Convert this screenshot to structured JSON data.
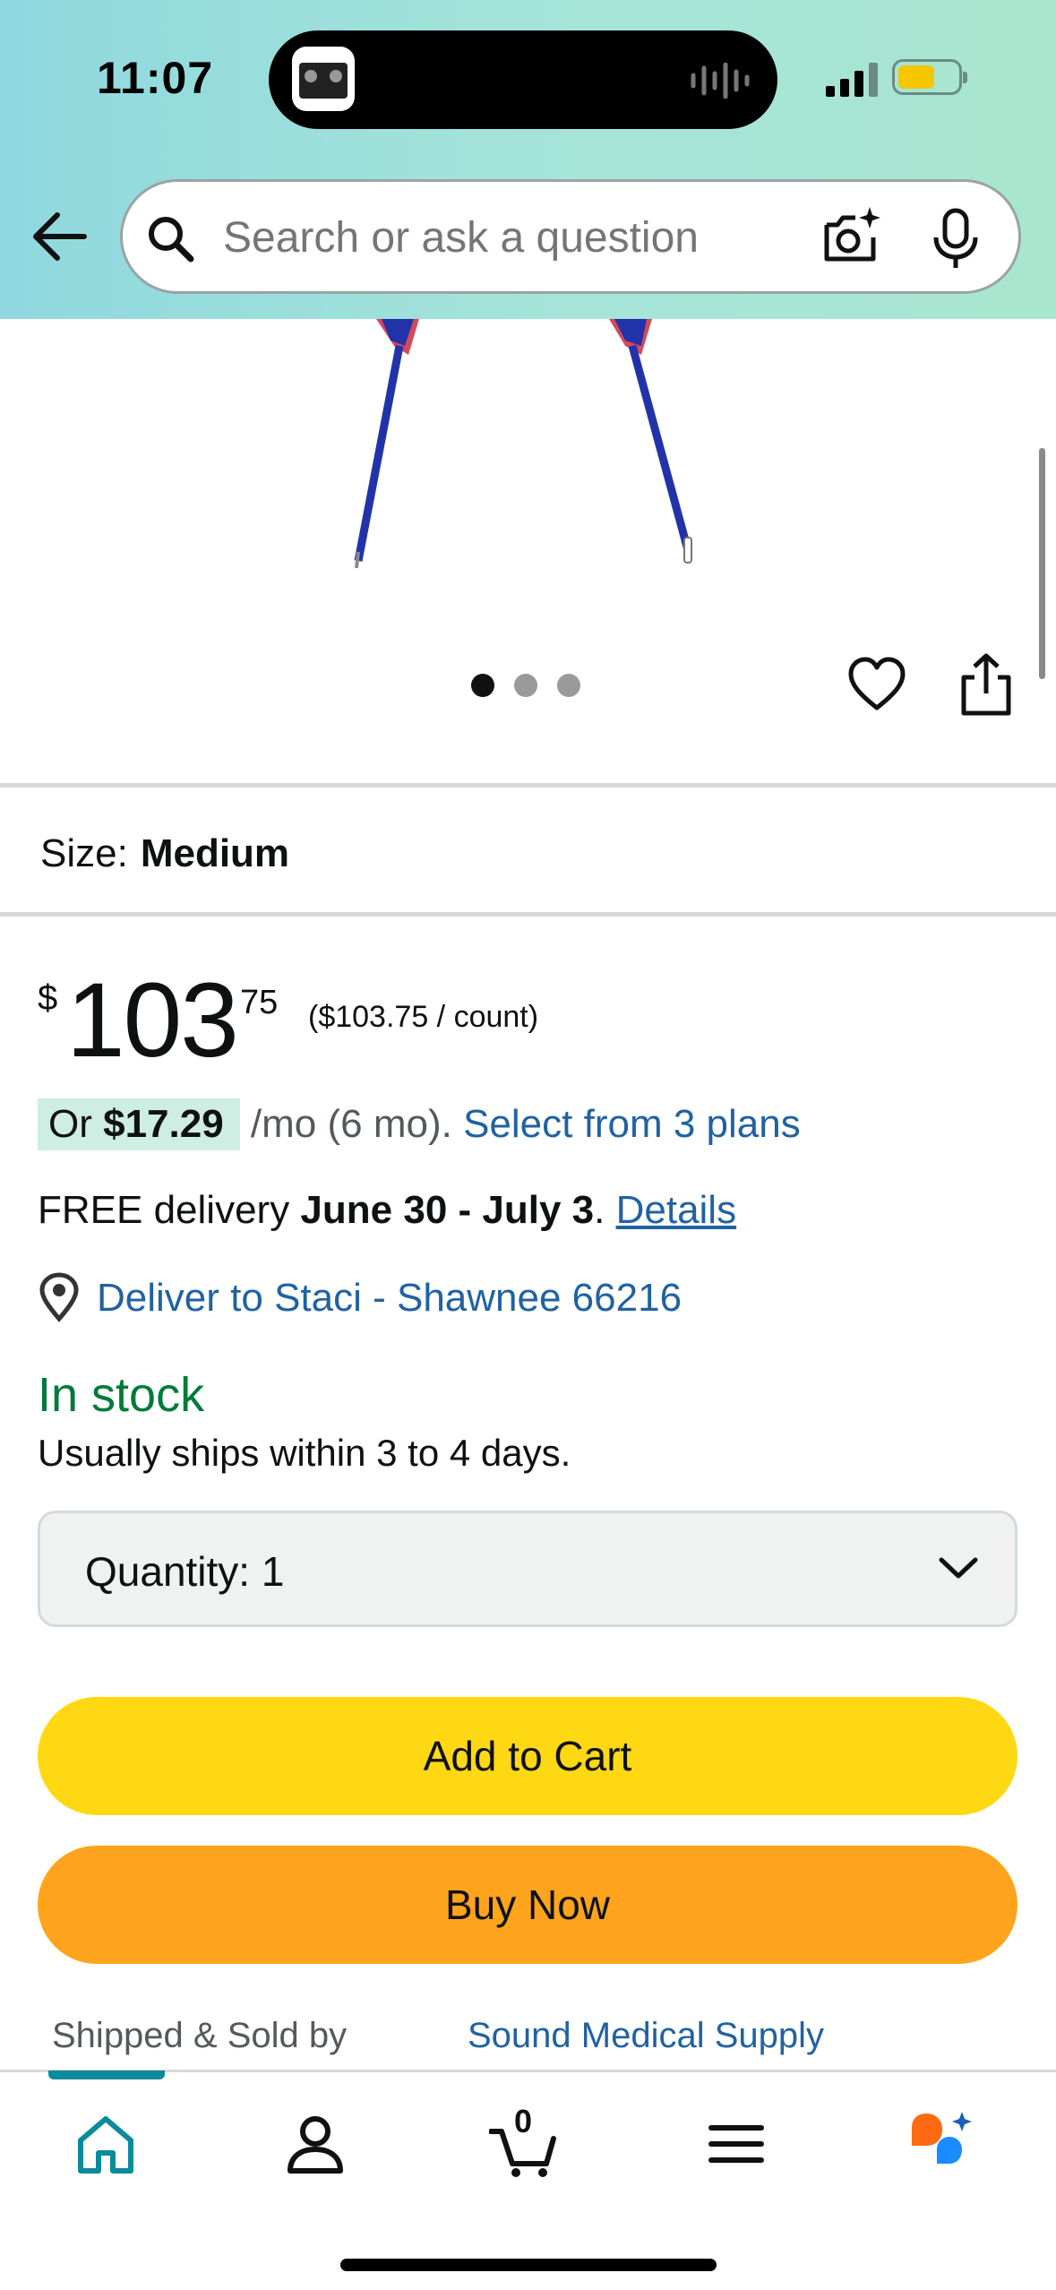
{
  "status_bar": {
    "time": "11:07"
  },
  "header": {
    "search_placeholder": "Search or ask a question",
    "icons": [
      "back-arrow-icon",
      "search-icon",
      "camera-icon",
      "mic-icon"
    ]
  },
  "gallery": {
    "image_count": 3,
    "active_index": 0
  },
  "product": {
    "size_label": "Size:",
    "size_value": "Medium",
    "price_symbol": "$",
    "price_whole": "103",
    "price_fraction": "75",
    "price_per_unit": "($103.75 / count)",
    "monthly_prefix": "Or ",
    "monthly_amount": "$17.29",
    "monthly_suffix": " /mo (6 mo).",
    "monthly_link": "Select from 3 plans",
    "delivery_prefix": "FREE delivery ",
    "delivery_dates": "June 30 - July 3",
    "delivery_period": ".",
    "delivery_link": "Details",
    "deliver_to": "Deliver to Staci - Shawnee 66216",
    "stock_status": "In stock",
    "ships_note": "Usually ships within 3 to 4 days.",
    "quantity_label": "Quantity:",
    "quantity_value": "1",
    "add_to_cart": "Add to Cart",
    "buy_now": "Buy Now",
    "shipped_sold_by_label": "Shipped & Sold by",
    "seller": "Sound Medical Supply"
  },
  "tabbar": {
    "cart_count": "0",
    "active_tab": "home",
    "tabs": [
      "home",
      "account",
      "cart",
      "menu",
      "rufus"
    ]
  },
  "colors": {
    "accent_teal": "#0a8b99",
    "link_blue": "#2162a1",
    "stock_green": "#007a39",
    "add_to_cart_yellow": "#ffd814",
    "buy_now_orange": "#ffa41c"
  }
}
